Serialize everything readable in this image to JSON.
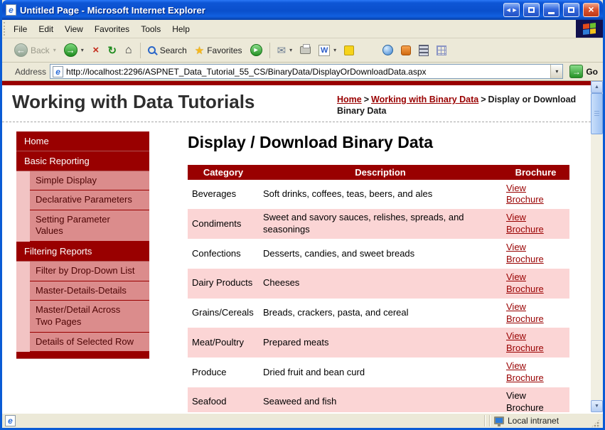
{
  "window": {
    "title": "Untitled Page - Microsoft Internet Explorer"
  },
  "icons": {
    "titlebar_arrows": "◄►",
    "close": "×",
    "back_arrow": "←",
    "forward_arrow": "→",
    "stop": "×",
    "refresh": "↻",
    "home": "⌂",
    "star": "★",
    "media": "▸",
    "mail": "✉",
    "dropdown": "▾",
    "word": "W",
    "go_arrow": "→",
    "scroll_up": "▲",
    "scroll_down": "▼",
    "crumb_sep": ">"
  },
  "menu": {
    "items": [
      "File",
      "Edit",
      "View",
      "Favorites",
      "Tools",
      "Help"
    ]
  },
  "toolbar": {
    "back_label": "Back",
    "search_label": "Search",
    "favorites_label": "Favorites"
  },
  "address": {
    "label": "Address",
    "url": "http://localhost:2296/ASPNET_Data_Tutorial_55_CS/BinaryData/DisplayOrDownloadData.aspx",
    "go_label": "Go"
  },
  "page": {
    "site_title": "Working with Data Tutorials",
    "breadcrumb": {
      "items": [
        {
          "label": "Home",
          "link": true
        },
        {
          "label": "Working with Binary Data",
          "link": true
        },
        {
          "label": "Display or Download Binary Data",
          "link": false
        }
      ]
    },
    "sidebar": {
      "items": [
        {
          "label": "Home",
          "type": "section"
        },
        {
          "label": "Basic Reporting",
          "type": "section"
        },
        {
          "label": "Simple Display",
          "type": "sub"
        },
        {
          "label": "Declarative Parameters",
          "type": "sub"
        },
        {
          "label": "Setting Parameter Values",
          "type": "sub"
        },
        {
          "label": "Filtering Reports",
          "type": "section"
        },
        {
          "label": "Filter by Drop-Down List",
          "type": "sub"
        },
        {
          "label": "Master-Details-Details",
          "type": "sub"
        },
        {
          "label": "Master/Detail Across Two Pages",
          "type": "sub"
        },
        {
          "label": "Details of Selected Row",
          "type": "sub"
        },
        {
          "label": "",
          "type": "section-partial"
        }
      ]
    },
    "main": {
      "title": "Display / Download Binary Data",
      "table": {
        "headers": [
          "Category",
          "Description",
          "Brochure"
        ],
        "rows": [
          {
            "category": "Beverages",
            "description": "Soft drinks, coffees, teas, beers, and ales",
            "brochure": "View Brochure",
            "is_link": true
          },
          {
            "category": "Condiments",
            "description": "Sweet and savory sauces, relishes, spreads, and seasonings",
            "brochure": "View Brochure",
            "is_link": true
          },
          {
            "category": "Confections",
            "description": "Desserts, candies, and sweet breads",
            "brochure": "View Brochure",
            "is_link": true
          },
          {
            "category": "Dairy Products",
            "description": "Cheeses",
            "brochure": "View Brochure",
            "is_link": true
          },
          {
            "category": "Grains/Cereals",
            "description": "Breads, crackers, pasta, and cereal",
            "brochure": "View Brochure",
            "is_link": true
          },
          {
            "category": "Meat/Poultry",
            "description": "Prepared meats",
            "brochure": "View Brochure",
            "is_link": true
          },
          {
            "category": "Produce",
            "description": "Dried fruit and bean curd",
            "brochure": "View Brochure",
            "is_link": true
          },
          {
            "category": "Seafood",
            "description": "Seaweed and fish",
            "brochure": "View Brochure",
            "is_link": false
          }
        ]
      }
    }
  },
  "statusbar": {
    "right": "Local intranet"
  },
  "colors": {
    "maroon": "#990000",
    "pink_row": "#FBD5D5",
    "sub_item_bg": "#DB8C8C",
    "sub_strip_bg": "#F2C4C4",
    "xp_blue": "#0A5BD5"
  }
}
